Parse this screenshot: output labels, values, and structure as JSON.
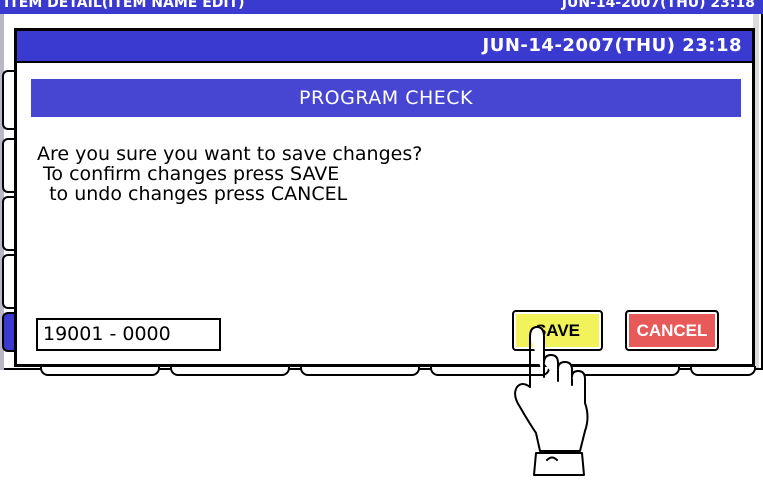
{
  "background_screen": {
    "title": "ITEM DETAIL(ITEM NAME EDIT)",
    "datetime": "JUN-14-2007(THU)  23:18"
  },
  "dialog": {
    "datetime": "JUN-14-2007(THU)  23:18",
    "heading": "PROGRAM CHECK",
    "message_lines": [
      "Are you sure you want to save changes?",
      " To confirm changes press SAVE",
      "  to undo changes press CANCEL"
    ],
    "record_code": "19001 - 0000",
    "save_label": "SAVE",
    "cancel_label": "CANCEL"
  },
  "colors": {
    "title_bar": "#3a3ad0",
    "heading_bar": "#4646d2",
    "save_button": "#f2f25a",
    "cancel_button": "#e85a5a"
  },
  "icons": {
    "pointer": "pointing-hand-icon"
  }
}
